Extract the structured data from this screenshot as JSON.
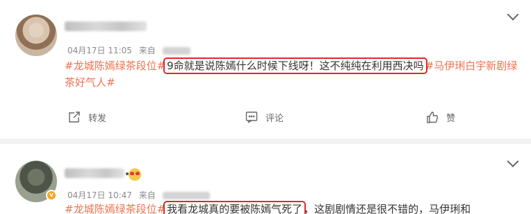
{
  "posts": [
    {
      "time": "04月17日 11:05",
      "source_prefix": "来自",
      "tag1": "#龙城陈嫣绿茶段位#",
      "highlight_text": "9命就是说陈嫣什么时候下线呀！这不纯纯在利用西决吗",
      "tag2": "#马伊琍白宇新剧绿茶好气人#",
      "actions": {
        "repost": "转发",
        "comment": "评论",
        "like": "赞"
      }
    },
    {
      "time": "04月17日 10:47",
      "source_prefix": "来自",
      "tag1": "#龙城陈嫣绿茶段位#",
      "highlight_text": "我看龙城真的要被陈嫣气死了",
      "trailing_text": "，这剧剧情还是很不错的，马伊琍和"
    }
  ],
  "colors": {
    "tag": "#eb7350",
    "highlight_border": "#e02727",
    "meta": "#8a8a8a"
  },
  "icons": [
    "chevron-down-icon",
    "repost-icon",
    "comment-icon",
    "like-icon",
    "verified-badge-icon",
    "emoji-icon"
  ]
}
